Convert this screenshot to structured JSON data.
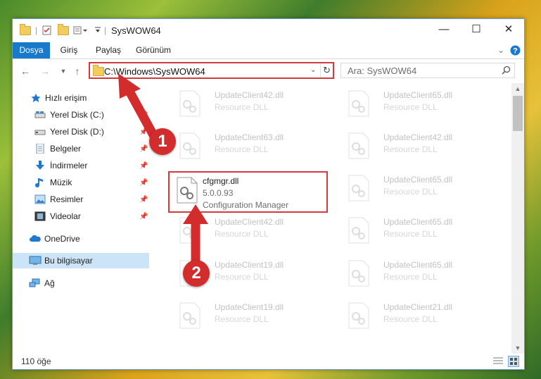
{
  "window": {
    "title": "SysWOW64"
  },
  "ribbon": {
    "tabs": [
      "Dosya",
      "Giriş",
      "Paylaş",
      "Görünüm"
    ]
  },
  "address": {
    "path": "C:\\Windows\\SysWOW64"
  },
  "search": {
    "placeholder": "Ara: SysWOW64"
  },
  "sidebar": {
    "quick_access": "Hızlı erişim",
    "items": [
      {
        "label": "Yerel Disk (C:)"
      },
      {
        "label": "Yerel Disk (D:)"
      },
      {
        "label": "Belgeler"
      },
      {
        "label": "İndirmeler"
      },
      {
        "label": "Müzik"
      },
      {
        "label": "Resimler"
      },
      {
        "label": "Videolar"
      }
    ],
    "onedrive": "OneDrive",
    "this_pc": "Bu bilgisayar",
    "network": "Ağ"
  },
  "files": {
    "left": [
      {
        "name": "UpdateClient42.dll",
        "type": "Resource DLL"
      },
      {
        "name": "UpdateClient63.dll",
        "type": "Resource DLL"
      },
      {
        "name": "cfgmgr.dll",
        "version": "5.0.0.93",
        "description": "Configuration Manager"
      },
      {
        "name": "UpdateClient42.dll",
        "type": "Resource DLL"
      },
      {
        "name": "UpdateClient19.dll",
        "type": "Resource DLL"
      },
      {
        "name": "UpdateClient19.dll",
        "type": "Resource DLL"
      }
    ],
    "right": [
      {
        "name": "UpdateClient65.dll",
        "type": "Resource DLL"
      },
      {
        "name": "UpdateClient42.dll",
        "type": "Resource DLL"
      },
      {
        "name": "UpdateClient65.dll",
        "type": "Resource DLL"
      },
      {
        "name": "UpdateClient65.dll",
        "type": "Resource DLL"
      },
      {
        "name": "UpdateClient65.dll",
        "type": "Resource DLL"
      },
      {
        "name": "UpdateClient21.dll",
        "type": "Resource DLL"
      }
    ]
  },
  "status": {
    "item_count": "110 öğe"
  },
  "annotations": {
    "step1": "1",
    "step2": "2",
    "color": "#d32c2c"
  }
}
